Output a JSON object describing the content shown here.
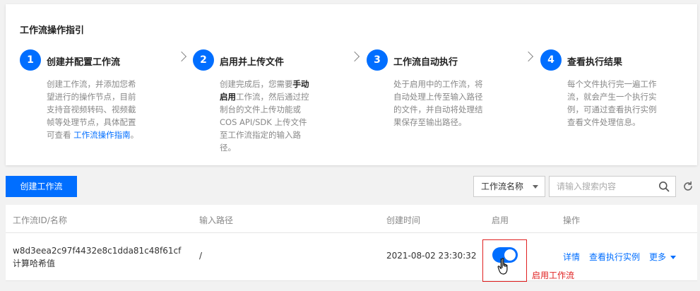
{
  "guide": {
    "title": "工作流操作指引",
    "steps": [
      {
        "num": "1",
        "title": "创建并配置工作流",
        "desc_before": "创建工作流，并添加您希望进行的操作节点，目前支持音视频转码、视频截帧等处理节点，具体配置可查看 ",
        "link": "工作流操作指南",
        "desc_after": "。"
      },
      {
        "num": "2",
        "title": "启用并上传文件",
        "desc_before": "创建完成后，您需要",
        "bold": "手动启用",
        "desc_after": "工作流，然后通过控制台的文件上传功能或 COS API/SDK 上传文件至工作流指定的输入路径。"
      },
      {
        "num": "3",
        "title": "工作流自动执行",
        "desc": "处于启用中的工作流，将自动处理上传至输入路径的文件，并自动将处理结果保存至输出路径。"
      },
      {
        "num": "4",
        "title": "查看执行结果",
        "desc": "每个文件执行完一遍工作流，就会产生一个执行实例，可通过查看执行实例查看文件处理信息。"
      }
    ]
  },
  "toolbar": {
    "create_label": "创建工作流",
    "filter_selected": "工作流名称",
    "search_placeholder": "请输入搜索内容"
  },
  "table": {
    "columns": [
      "工作流ID/名称",
      "输入路径",
      "创建时间",
      "启用",
      "操作"
    ],
    "rows": [
      {
        "id": "w8d3eea2c97f4432e8c1dda81c48f61cf",
        "name": "计算哈希值",
        "input_path": "/",
        "created": "2021-08-02 23:30:32",
        "enabled": true,
        "actions": {
          "detail": "详情",
          "instances": "查看执行实例",
          "more": "更多"
        }
      }
    ]
  },
  "annotation": "启用工作流",
  "colors": {
    "accent": "#006eff",
    "annotation": "#e02020"
  }
}
